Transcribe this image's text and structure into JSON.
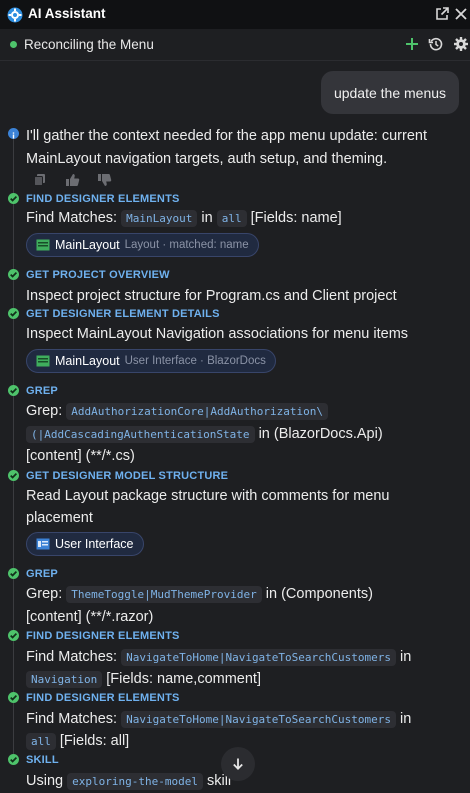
{
  "app": {
    "title": "AI Assistant"
  },
  "conversation": {
    "title": "Reconciling the Menu",
    "status_color": "#4ec36b"
  },
  "user_message": "update the menus",
  "intro": {
    "line1": "I'll gather the context needed for the app menu update: current",
    "line2": "MainLayout navigation targets, auth setup, and theming."
  },
  "steps": [
    {
      "heading": "FIND DESIGNER ELEMENTS",
      "prefix": "Find Matches:",
      "code1": "MainLayout",
      "mid": "in",
      "code2": "all",
      "suffix": "[Fields: name]",
      "chip": {
        "label": "MainLayout",
        "sub": "Layout · matched: name"
      }
    },
    {
      "heading": "GET PROJECT OVERVIEW",
      "text": "Inspect project structure for Program.cs and Client project"
    },
    {
      "heading": "GET DESIGNER ELEMENT DETAILS",
      "text": "Inspect MainLayout Navigation associations for menu items",
      "chip": {
        "label": "MainLayout",
        "sub": "User Interface · BlazorDocs"
      }
    },
    {
      "heading": "GREP",
      "prefix": "Grep:",
      "code1": "AddAuthorizationCore|AddAuthorization\\",
      "code2": "(|AddCascadingAuthenticationState",
      "mid": "in (BlazorDocs.Api)",
      "line3": "[content] (**/*.cs)"
    },
    {
      "heading": "GET DESIGNER MODEL STRUCTURE",
      "line1": "Read Layout package structure with comments for menu",
      "line2": "placement",
      "chip": {
        "label": "User Interface"
      }
    },
    {
      "heading": "GREP",
      "prefix": "Grep:",
      "code1": "ThemeToggle|MudThemeProvider",
      "mid": "in (Components)",
      "line2": "[content] (**/*.razor)"
    },
    {
      "heading": "FIND DESIGNER ELEMENTS",
      "prefix": "Find Matches:",
      "code1": "NavigateToHome|NavigateToSearchCustomers",
      "mid": "in",
      "code2": "Navigation",
      "suffix": "[Fields: name,comment]"
    },
    {
      "heading": "FIND DESIGNER ELEMENTS",
      "prefix": "Find Matches:",
      "code1": "NavigateToHome|NavigateToSearchCustomers",
      "mid": "in",
      "code2": "all",
      "suffix": "[Fields: all]"
    },
    {
      "heading": "SKILL",
      "prefix": "Using",
      "code1": "exploring-the-model",
      "suffix": "skill"
    }
  ],
  "icons": {
    "logo": "gear-logo-icon",
    "popout": "open-external-icon",
    "close": "close-icon",
    "new_chat": "plus-icon",
    "history": "history-icon",
    "settings": "gear-icon",
    "copy": "copy-icon",
    "thumbs_up": "thumbs-up-icon",
    "thumbs_down": "thumbs-down-icon",
    "scroll_down": "arrow-down-icon"
  },
  "colors": {
    "accent": "#6fb1ef",
    "success": "#4ec36b",
    "info": "#3b82d6",
    "background": "#1e1f22"
  }
}
